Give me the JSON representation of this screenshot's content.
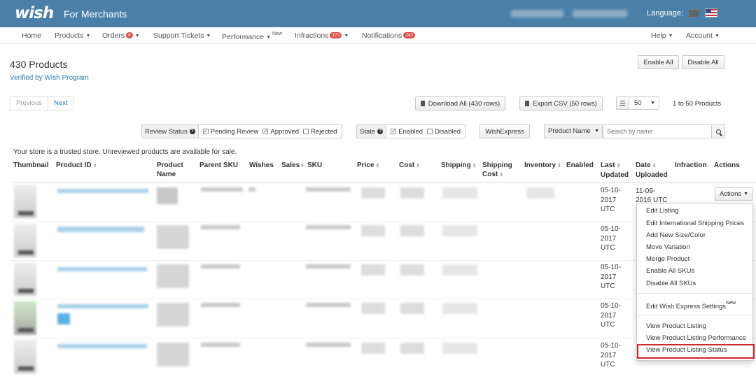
{
  "header": {
    "logo": "wish",
    "subtitle": "For Merchants",
    "language_label": "Language:"
  },
  "nav": {
    "home": "Home",
    "products": "Products",
    "orders": "Orders",
    "orders_badge": "6",
    "support": "Support Tickets",
    "performance": "Performance",
    "performance_new": "New",
    "infractions": "Infractions",
    "infractions_badge": "172",
    "notifications": "Notifications",
    "notifications_badge": "242",
    "help": "Help",
    "account": "Account"
  },
  "page": {
    "title": "430 Products",
    "verified": "Verified by Wish Program",
    "enable_all": "Enable All",
    "disable_all": "Disable All",
    "previous": "Previous",
    "next": "Next",
    "download_all": "Download All (430 rows)",
    "export_csv": "Export CSV (50 rows)",
    "page_size": "50",
    "range": "1 to 50 Products",
    "trusted_note": "Your store is a trusted store. Unreviewed products are available for sale."
  },
  "filters": {
    "review_status": "Review Status",
    "pending": "Pending Review",
    "approved": "Approved",
    "rejected": "Rejected",
    "state": "State",
    "enabled": "Enabled",
    "disabled": "Disabled",
    "wishexpress": "WishExpress",
    "search_field": "Product Name",
    "search_placeholder": "Search by name"
  },
  "columns": {
    "thumbnail": "Thumbnail",
    "product_id": "Product ID",
    "product_name_1": "Product",
    "product_name_2": "Name",
    "parent_sku": "Parent SKU",
    "wishes": "Wishes",
    "sales": "Sales",
    "sku": "SKU",
    "price": "Price",
    "cost": "Cost",
    "shipping": "Shipping",
    "shipping_cost_1": "Shipping",
    "shipping_cost_2": "Cost",
    "inventory": "Inventory",
    "enabled": "Enabled",
    "last_updated_1": "Last",
    "last_updated_2": "Updated",
    "date_uploaded_1": "Date",
    "date_uploaded_2": "Uploaded",
    "infraction": "Infraction",
    "actions": "Actions"
  },
  "rows": [
    {
      "date": "05-10-",
      "year": "2017",
      "tz": "UTC"
    },
    {
      "date": "05-10-",
      "year": "2017",
      "tz": "UTC"
    },
    {
      "date": "05-10-",
      "year": "2017",
      "tz": "UTC"
    },
    {
      "date": "05-10-",
      "year": "2017",
      "tz": "UTC"
    },
    {
      "date": "05-10-",
      "year": "2017",
      "tz": "UTC"
    }
  ],
  "first_row_uploaded": {
    "date": "11-09-",
    "rest": "2016 UTC"
  },
  "actions_button": "Actions",
  "actions_menu": {
    "edit_listing": "Edit Listing",
    "edit_intl_shipping": "Edit International Shipping Prices",
    "add_size_color": "Add New Size/Color",
    "move_variation": "Move Variation",
    "merge_product": "Merge Product",
    "enable_skus": "Enable All SKUs",
    "disable_skus": "Disable All SKUs",
    "edit_wish_express": "Edit Wish Express Settings",
    "wish_express_new": "New",
    "view_listing": "View Product Listing",
    "view_performance": "View Product Listing Performance",
    "view_status": "View Product Listing Status"
  },
  "colors": {
    "header_bg": "#4a7fa8",
    "badge": "#d9534f",
    "link": "#2a7ab0",
    "highlight": "#d0262c"
  }
}
